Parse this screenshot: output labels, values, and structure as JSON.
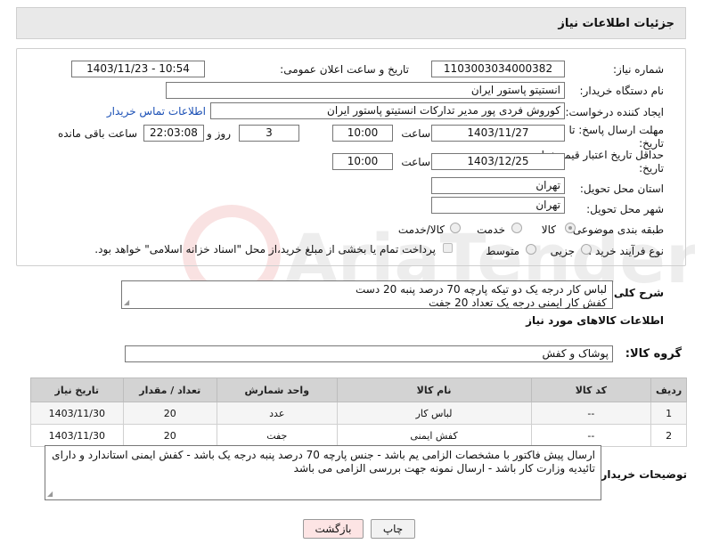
{
  "header": {
    "title": "جزئیات اطلاعات نیاز"
  },
  "form": {
    "need_number_label": "شماره نیاز:",
    "need_number": "1103003034000382",
    "announce_datetime_label": "تاریخ و ساعت اعلان عمومی:",
    "announce_datetime": "1403/11/23 - 10:54",
    "buyer_org_label": "نام دستگاه خریدار:",
    "buyer_org": "انستیتو پاستور ایران",
    "requester_label": "ایجاد کننده درخواست:",
    "requester": "کوروش فردی پور مدیر تدارکات انستیتو پاستور ایران",
    "buyer_contact_link": "اطلاعات تماس خریدار",
    "reply_deadline_label_1": "مهلت ارسال پاسخ: تا",
    "reply_deadline_label_2": "تاریخ:",
    "reply_date": "1403/11/27",
    "time_label": "ساعت",
    "reply_time": "10:00",
    "days_value": "3",
    "days_label": "روز و",
    "remaining_time": "22:03:08",
    "remaining_label": "ساعت باقی مانده",
    "price_validity_label_1": "حداقل تاریخ اعتبار قیمت: تا",
    "price_validity_label_2": "تاریخ:",
    "validity_date": "1403/12/25",
    "validity_time": "10:00",
    "province_label": "استان محل تحویل:",
    "province": "تهران",
    "city_label": "شهر محل تحویل:",
    "city": "تهران",
    "category_label": "طبقه بندی موضوعی:",
    "category_options": [
      "کالا",
      "خدمت",
      "کالا/خدمت"
    ],
    "process_label": "نوع فرآیند خرید :",
    "process_options": [
      "جزیی",
      "متوسط"
    ],
    "payment_note": "پرداخت تمام یا بخشی از مبلغ خرید،از محل \"اسناد خزانه اسلامی\" خواهد بود."
  },
  "description": {
    "label": "شرح کلی نیاز:",
    "line1": "لباس کار درجه یک دو تیکه پارچه 70 درصد پنبه 20 دست",
    "line2": "کفش کار  ایمنی درجه یک  تعداد 20 جفت"
  },
  "goods": {
    "section_title": "اطلاعات کالاهای مورد نیاز",
    "group_label": "گروه کالا:",
    "group_value": "پوشاک و کفش",
    "columns": [
      "ردیف",
      "کد کالا",
      "نام کالا",
      "واحد شمارش",
      "تعداد / مقدار",
      "تاریخ نیاز"
    ],
    "rows": [
      {
        "row": "1",
        "code": "--",
        "name": "لباس کار",
        "unit": "عدد",
        "qty": "20",
        "date": "1403/11/30"
      },
      {
        "row": "2",
        "code": "--",
        "name": "کفش ایمنی",
        "unit": "جفت",
        "qty": "20",
        "date": "1403/11/30"
      }
    ]
  },
  "buyer_notes": {
    "label": "توضیحات خریدار:",
    "text": "ارسال پیش فاکتور با مشخصات الزامی یم باشد - جنس پارچه 70 درصد پنبه درجه یک باشد - کفش ایمنی استاندارد و دارای تائیدیه وزارت کار باشد - ارسال نمونه جهت بررسی الزامی می باشد"
  },
  "buttons": {
    "print": "چاپ",
    "back": "بازگشت"
  },
  "watermark_text": "AriaTender.neT",
  "colors": {
    "link": "#1a4fb5",
    "back_button_bg": "#fde4e4",
    "header_bg": "#e9e9e9",
    "table_header_bg": "#d3d3d3"
  }
}
